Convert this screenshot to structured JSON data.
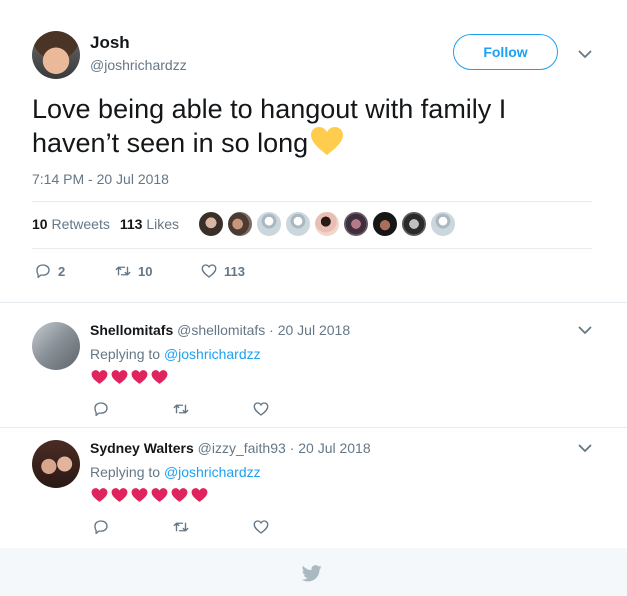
{
  "tweet": {
    "author_name": "Josh",
    "author_handle": "@joshrichardzz",
    "follow_label": "Follow",
    "text": "Love being able to hangout with family I haven’t seen in so long",
    "emoji": "yellow-heart",
    "timestamp": "7:14 PM - 20 Jul 2018",
    "retweets_count": "10",
    "retweets_label": "Retweets",
    "likes_count": "113",
    "likes_label": "Likes",
    "liker_avatars": 9,
    "actions": {
      "replies": "2",
      "retweets": "10",
      "likes": "113"
    }
  },
  "replies": [
    {
      "name": "Shellomitafs",
      "handle": "@shellomitafs",
      "date": "· 20 Jul 2018",
      "replying_prefix": "Replying to",
      "replying_to": "@joshrichardzz",
      "hearts": 4
    },
    {
      "name": "Sydney Walters",
      "handle": "@izzy_faith93",
      "date": "· 20 Jul 2018",
      "replying_prefix": "Replying to",
      "replying_to": "@joshrichardzz",
      "hearts": 6
    }
  ],
  "colors": {
    "accent": "#1da1f2",
    "secondary_text": "#657786",
    "red_heart": "#e0245e",
    "yellow_heart": "#ffcc4d",
    "divider": "#e6ecf0",
    "footer_bg": "#f5f8fa"
  },
  "icons": {
    "reply": "reply-icon",
    "retweet": "retweet-icon",
    "like": "heart-outline-icon",
    "more": "chevron-down-icon",
    "brand": "twitter-bird-icon"
  }
}
